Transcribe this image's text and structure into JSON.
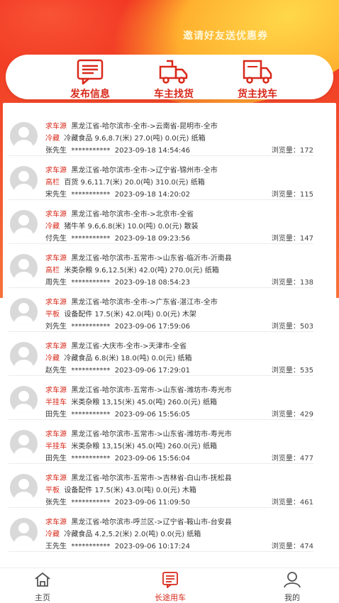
{
  "banner": {
    "invite_text": "邀请好友送优惠券"
  },
  "top_actions": [
    {
      "label": "发布信息",
      "icon": "document-list-icon"
    },
    {
      "label": "车主找货",
      "icon": "truck-empty-icon"
    },
    {
      "label": "货主找车",
      "icon": "truck-cargo-icon"
    }
  ],
  "listings": [
    {
      "tag": "求车源",
      "route": "黑龙江省-哈尔滨市-全市->云南省-昆明市-全市",
      "car_type": "冷藏",
      "details": "冷藏食品  9.6,8.7(米)  27.0(吨)  0.0(元)  纸箱",
      "contact": "张先生",
      "phone_masked": "***********",
      "time": "2023-09-18 14:54:46",
      "views": "浏览量：172"
    },
    {
      "tag": "求车源",
      "route": "黑龙江省-哈尔滨市-全市->辽宁省-锦州市-全市",
      "car_type": "高栏",
      "details": "百货  9.6,11.7(米)  20.0(吨)  310.0(元)  纸箱",
      "contact": "宋先生",
      "phone_masked": "***********",
      "time": "2023-09-18 14:20:02",
      "views": "浏览量：115"
    },
    {
      "tag": "求车源",
      "route": "黑龙江省-哈尔滨市-全市->北京市-全省",
      "car_type": "冷藏",
      "details": "猪牛羊  9.6,6.8(米)  10.0(吨)  0.0(元)  散装",
      "contact": "付先生",
      "phone_masked": "***********",
      "time": "2023-09-18 09:23:56",
      "views": "浏览量：147"
    },
    {
      "tag": "求车源",
      "route": "黑龙江省-哈尔滨市-五常市->山东省-临沂市-沂南县",
      "car_type": "高栏",
      "details": "米类杂粮  9.6,12.5(米)  42.0(吨)  270.0(元)  纸箱",
      "contact": "周先生",
      "phone_masked": "***********",
      "time": "2023-09-18 08:54:23",
      "views": "浏览量：138"
    },
    {
      "tag": "求车源",
      "route": "黑龙江省-哈尔滨市-全市->广东省-湛江市-全市",
      "car_type": "平板",
      "details": "设备配件  17.5(米)  42.0(吨)  0.0(元)  木架",
      "contact": "刘先生",
      "phone_masked": "***********",
      "time": "2023-09-06 17:59:06",
      "views": "浏览量：503"
    },
    {
      "tag": "求车源",
      "route": "黑龙江省-大庆市-全市->天津市-全省",
      "car_type": "冷藏",
      "details": "冷藏食品  6.8(米)  18.0(吨)  0.0(元)  纸箱",
      "contact": "赵先生",
      "phone_masked": "***********",
      "time": "2023-09-06 17:29:01",
      "views": "浏览量：535"
    },
    {
      "tag": "求车源",
      "route": "黑龙江省-哈尔滨市-五常市->山东省-潍坊市-寿光市",
      "car_type": "半挂车",
      "details": "米类杂粮  13,15(米)  45.0(吨)  260.0(元)  纸箱",
      "contact": "田先生",
      "phone_masked": "***********",
      "time": "2023-09-06 15:56:05",
      "views": "浏览量：429"
    },
    {
      "tag": "求车源",
      "route": "黑龙江省-哈尔滨市-五常市->山东省-潍坊市-寿光市",
      "car_type": "半挂车",
      "details": "米类杂粮  13,15(米)  45.0(吨)  260.0(元)  纸箱",
      "contact": "田先生",
      "phone_masked": "***********",
      "time": "2023-09-06 15:56:04",
      "views": "浏览量：477"
    },
    {
      "tag": "求车源",
      "route": "黑龙江省-哈尔滨市-五常市->吉林省-白山市-抚松县",
      "car_type": "平板",
      "details": "设备配件  17.5(米)  43.0(吨)  0.0(元)  木箱",
      "contact": "张先生",
      "phone_masked": "***********",
      "time": "2023-09-06 11:09:50",
      "views": "浏览量：461"
    },
    {
      "tag": "求车源",
      "route": "黑龙江省-哈尔滨市-呼兰区->辽宁省-鞍山市-台安县",
      "car_type": "冷藏",
      "details": "冷藏食品  4.2,5.2(米)  2.0(吨)  0.0(元)  纸箱",
      "contact": "王先生",
      "phone_masked": "***********",
      "time": "2023-09-06 10:17:24",
      "views": "浏览量：474"
    }
  ],
  "bottom_nav": [
    {
      "label": "主页",
      "icon": "home-icon",
      "active": false
    },
    {
      "label": "长途用车",
      "icon": "list-card-icon",
      "active": true
    },
    {
      "label": "我的",
      "icon": "user-icon",
      "active": false
    }
  ],
  "colors": {
    "accent": "#d8281a",
    "banner_top": "#f0301f",
    "banner_bottom": "#f7733a",
    "gold": "#ffc83a"
  }
}
